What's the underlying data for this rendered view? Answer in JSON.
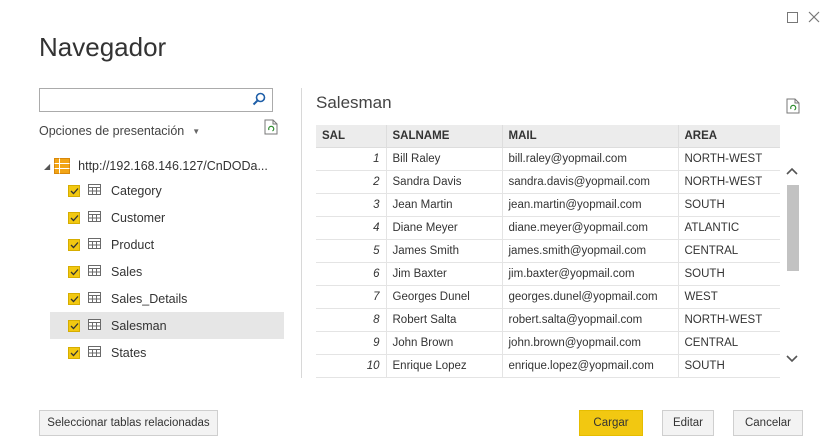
{
  "dialog": {
    "title": "Navegador"
  },
  "search": {
    "placeholder": "",
    "value": ""
  },
  "display_options": {
    "label": "Opciones de presentación"
  },
  "tree": {
    "root_label": "http://192.168.146.127/CnDODa...",
    "items": [
      {
        "label": "Category",
        "checked": true,
        "selected": false
      },
      {
        "label": "Customer",
        "checked": true,
        "selected": false
      },
      {
        "label": "Product",
        "checked": true,
        "selected": false
      },
      {
        "label": "Sales",
        "checked": true,
        "selected": false
      },
      {
        "label": "Sales_Details",
        "checked": true,
        "selected": false
      },
      {
        "label": "Salesman",
        "checked": true,
        "selected": true
      },
      {
        "label": "States",
        "checked": true,
        "selected": false
      }
    ]
  },
  "preview": {
    "title": "Salesman",
    "columns": [
      "SAL",
      "SALNAME",
      "MAIL",
      "AREA"
    ],
    "rows": [
      [
        "1",
        "Bill Raley",
        "bill.raley@yopmail.com",
        "NORTH-WEST"
      ],
      [
        "2",
        "Sandra Davis",
        "sandra.davis@yopmail.com",
        "NORTH-WEST"
      ],
      [
        "3",
        "Jean Martin",
        "jean.martin@yopmail.com",
        "SOUTH"
      ],
      [
        "4",
        "Diane Meyer",
        "diane.meyer@yopmail.com",
        "ATLANTIC"
      ],
      [
        "5",
        "James Smith",
        "james.smith@yopmail.com",
        "CENTRAL"
      ],
      [
        "6",
        "Jim Baxter",
        "jim.baxter@yopmail.com",
        "SOUTH"
      ],
      [
        "7",
        "Georges Dunel",
        "georges.dunel@yopmail.com",
        "WEST"
      ],
      [
        "8",
        "Robert Salta",
        "robert.salta@yopmail.com",
        "NORTH-WEST"
      ],
      [
        "9",
        "John Brown",
        "john.brown@yopmail.com",
        "CENTRAL"
      ],
      [
        "10",
        "Enrique Lopez",
        "enrique.lopez@yopmail.com",
        "SOUTH"
      ]
    ]
  },
  "footer": {
    "select_related_label": "Seleccionar tablas relacionadas",
    "load_label": "Cargar",
    "edit_label": "Editar",
    "cancel_label": "Cancelar"
  },
  "colors": {
    "accent": "#f2c811",
    "selected_row": "#e6e6e6",
    "header_bg": "#ececec"
  },
  "icons": [
    "maximize-icon",
    "close-icon",
    "search-icon",
    "refresh-icon",
    "database-icon",
    "table-icon",
    "checkbox-icon",
    "scroll-up-icon",
    "scroll-down-icon"
  ]
}
